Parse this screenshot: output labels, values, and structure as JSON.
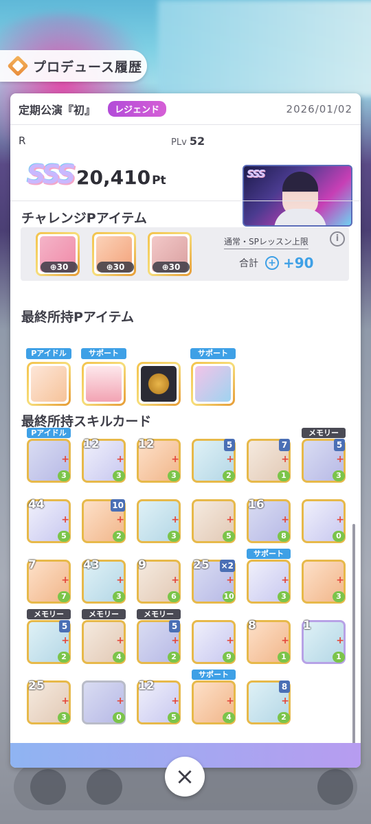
{
  "header": {
    "title": "プロデュース履歴"
  },
  "record": {
    "name": "定期公演『初』",
    "difficulty_badge": "レジェンド",
    "date": "2026/01/02",
    "rank_label": "R",
    "plv_label": "PLv",
    "plv_value": "52",
    "grade": "SSS",
    "score": "20,410",
    "score_unit": "Pt"
  },
  "challenge": {
    "title": "チャレンジPアイテム",
    "items": [
      {
        "icon": "pink-device-icon",
        "badge": "30",
        "color": "#f08aa8"
      },
      {
        "icon": "star-earrings-icon",
        "badge": "30",
        "color": "#f3a27a"
      },
      {
        "icon": "jacket-icon",
        "badge": "30",
        "color": "#d9a0a0"
      }
    ],
    "note": "通常・SPレッスン上限",
    "total_label": "合計",
    "total_value": "+90"
  },
  "owned_items": {
    "title": "最終所持Pアイテム",
    "items": [
      {
        "tag": "Pアイドル",
        "tag_color": "#3ea0e6",
        "icon": "flower-hairpin-icon"
      },
      {
        "tag": "サポート",
        "tag_color": "#3ea0e6",
        "icon": "candle-icon"
      },
      {
        "tag": "",
        "tag_color": "",
        "icon": "gold-coin-card-icon"
      },
      {
        "tag": "サポート",
        "tag_color": "#3ea0e6",
        "icon": "star-charm-icon"
      }
    ]
  },
  "skill_cards": {
    "title": "最終所持スキルカード",
    "rows": [
      [
        {
          "tag": "Pアイドル",
          "tag_color": "#3ea0e6",
          "cost": "",
          "lvl": "",
          "heart": "3",
          "frame": "gold"
        },
        {
          "tag": "",
          "cost": "12",
          "lvl": "",
          "heart": "3",
          "frame": "gold"
        },
        {
          "tag": "",
          "cost": "12",
          "lvl": "",
          "heart": "3",
          "frame": "gold"
        },
        {
          "tag": "",
          "cost": "",
          "lvl": "5",
          "heart": "2",
          "frame": "gold"
        },
        {
          "tag": "",
          "cost": "",
          "lvl": "7",
          "heart": "1",
          "frame": "gold"
        },
        {
          "tag": "メモリー",
          "tag_color": "#4a4a54",
          "cost": "",
          "lvl": "5",
          "heart": "3",
          "frame": "gold"
        }
      ],
      [
        {
          "tag": "",
          "cost": "44",
          "lvl": "",
          "heart": "5",
          "frame": "gold"
        },
        {
          "tag": "",
          "cost": "",
          "lvl": "10",
          "heart": "2",
          "frame": "gold"
        },
        {
          "tag": "",
          "cost": "",
          "lvl": "",
          "heart": "3",
          "frame": "gold"
        },
        {
          "tag": "",
          "cost": "",
          "lvl": "",
          "heart": "5",
          "frame": "gold"
        },
        {
          "tag": "",
          "cost": "16",
          "lvl": "",
          "heart": "8",
          "frame": "gold"
        },
        {
          "tag": "",
          "cost": "",
          "lvl": "",
          "heart": "0",
          "frame": "gold"
        }
      ],
      [
        {
          "tag": "",
          "cost": "7",
          "lvl": "",
          "heart": "7",
          "frame": "gold"
        },
        {
          "tag": "",
          "cost": "43",
          "lvl": "",
          "heart": "3",
          "frame": "gold"
        },
        {
          "tag": "",
          "cost": "9",
          "lvl": "",
          "heart": "6",
          "frame": "gold"
        },
        {
          "tag": "",
          "cost": "25",
          "lvl": "×2",
          "heart": "10",
          "frame": "gold"
        },
        {
          "tag": "サポート",
          "tag_color": "#3ea0e6",
          "cost": "",
          "lvl": "",
          "heart": "3",
          "frame": "gold"
        },
        {
          "tag": "",
          "cost": "",
          "lvl": "",
          "heart": "3",
          "frame": "gold"
        }
      ],
      [
        {
          "tag": "メモリー",
          "tag_color": "#4a4a54",
          "cost": "",
          "lvl": "5",
          "heart": "2",
          "frame": "gold"
        },
        {
          "tag": "メモリー",
          "tag_color": "#4a4a54",
          "cost": "",
          "lvl": "",
          "heart": "4",
          "frame": "gold"
        },
        {
          "tag": "メモリー",
          "tag_color": "#4a4a54",
          "cost": "",
          "lvl": "5",
          "heart": "2",
          "frame": "gold"
        },
        {
          "tag": "",
          "cost": "",
          "lvl": "",
          "heart": "9",
          "frame": "gold"
        },
        {
          "tag": "",
          "cost": "8",
          "lvl": "",
          "heart": "1",
          "frame": "gold"
        },
        {
          "tag": "",
          "cost": "1",
          "lvl": "",
          "heart": "1",
          "frame": "purple"
        }
      ],
      [
        {
          "tag": "",
          "cost": "25",
          "lvl": "",
          "heart": "3",
          "frame": "gold"
        },
        {
          "tag": "",
          "cost": "",
          "lvl": "",
          "heart": "0",
          "frame": "silver"
        },
        {
          "tag": "",
          "cost": "12",
          "lvl": "",
          "heart": "5",
          "frame": "gold"
        },
        {
          "tag": "サポート",
          "tag_color": "#3ea0e6",
          "cost": "",
          "lvl": "",
          "heart": "4",
          "frame": "gold"
        },
        {
          "tag": "",
          "cost": "",
          "lvl": "8",
          "heart": "2",
          "frame": "gold"
        }
      ]
    ]
  },
  "close_button": {
    "icon": "close-icon",
    "label": "×"
  }
}
